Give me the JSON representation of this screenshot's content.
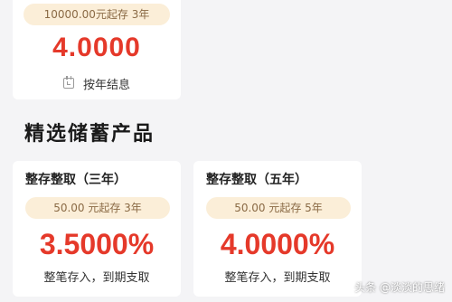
{
  "top_product": {
    "min_deposit": "10000.00元起存 3年",
    "rate": "4.0000",
    "interest_method": "按年结息",
    "interest_icon": "calendar-icon"
  },
  "section": {
    "title": "精选储蓄产品"
  },
  "products": [
    {
      "name": "整存整取（三年）",
      "min_deposit": "50.00 元起存 3年",
      "rate": "3.5000%",
      "terms": "整笔存入，到期支取"
    },
    {
      "name": "整存整取（五年）",
      "min_deposit": "50.00 元起存 5年",
      "rate": "4.0000%",
      "terms": "整笔存入，到期支取"
    }
  ],
  "watermark": {
    "text": "头条 @淡淡的思绪"
  },
  "colors": {
    "accent_red": "#e5392a",
    "pill_bg": "#fbeed8",
    "pill_text": "#8a6a45",
    "page_bg": "#f4f4f6"
  }
}
